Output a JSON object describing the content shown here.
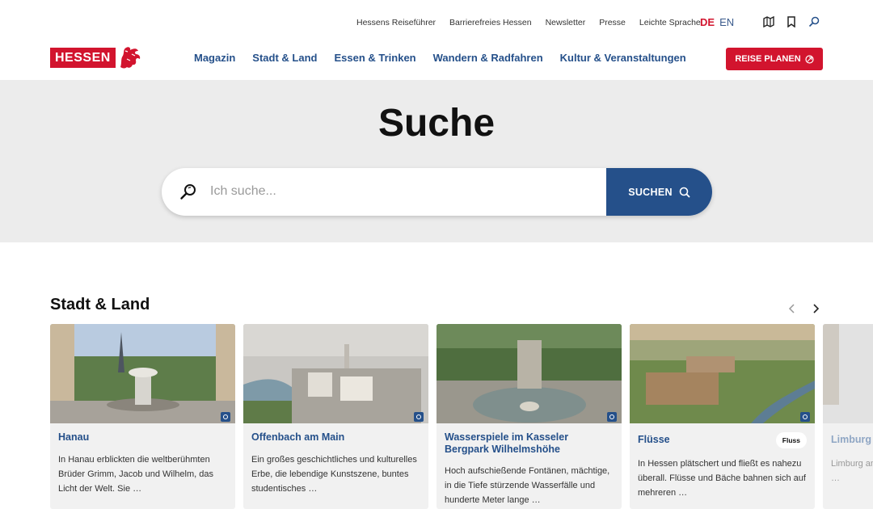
{
  "util_links": [
    "Hessens Reiseführer",
    "Barrierefreies Hessen",
    "Newsletter",
    "Presse",
    "Leichte Sprache"
  ],
  "lang": {
    "de": "DE",
    "en": "EN"
  },
  "logo_text": "HESSEN",
  "nav": [
    "Magazin",
    "Stadt & Land",
    "Essen & Trinken",
    "Wandern & Radfahren",
    "Kultur & Veranstaltungen"
  ],
  "cta_label": "REISE PLANEN",
  "hero_title": "Suche",
  "search": {
    "placeholder": "Ich suche...",
    "value": "",
    "button_label": "SUCHEN"
  },
  "section_title": "Stadt & Land",
  "cards": [
    {
      "title": "Hanau",
      "text": "In Hanau erblickten die weltberühmten Brüder Grimm, Jacob und Wilhelm, das Licht der Welt. Sie …",
      "tag": ""
    },
    {
      "title": "Offenbach am Main",
      "text": "Ein großes geschichtliches und kulturelles Erbe, die lebendige Kunstszene, buntes studentisches …",
      "tag": ""
    },
    {
      "title": "Wasserspiele im Kasseler Bergpark Wilhelmshöhe",
      "text": "Hoch aufschießende Fontänen, mächtige, in die Tiefe stürzende Wasserfälle und hunderte Meter lange …",
      "tag": ""
    },
    {
      "title": "Flüsse",
      "text": "In Hessen plätschert und fließt es nahezu überall. Flüsse und Bäche bahnen sich auf mehreren …",
      "tag": "Fluss"
    },
    {
      "title": "Limburg",
      "text": "Limburg an … Geschichte … miteinander …",
      "tag": ""
    }
  ],
  "colors": {
    "brand_red": "#d2142e",
    "brand_blue": "#25508a",
    "hero_bg": "#ececec",
    "card_bg": "#f1f1f1"
  }
}
